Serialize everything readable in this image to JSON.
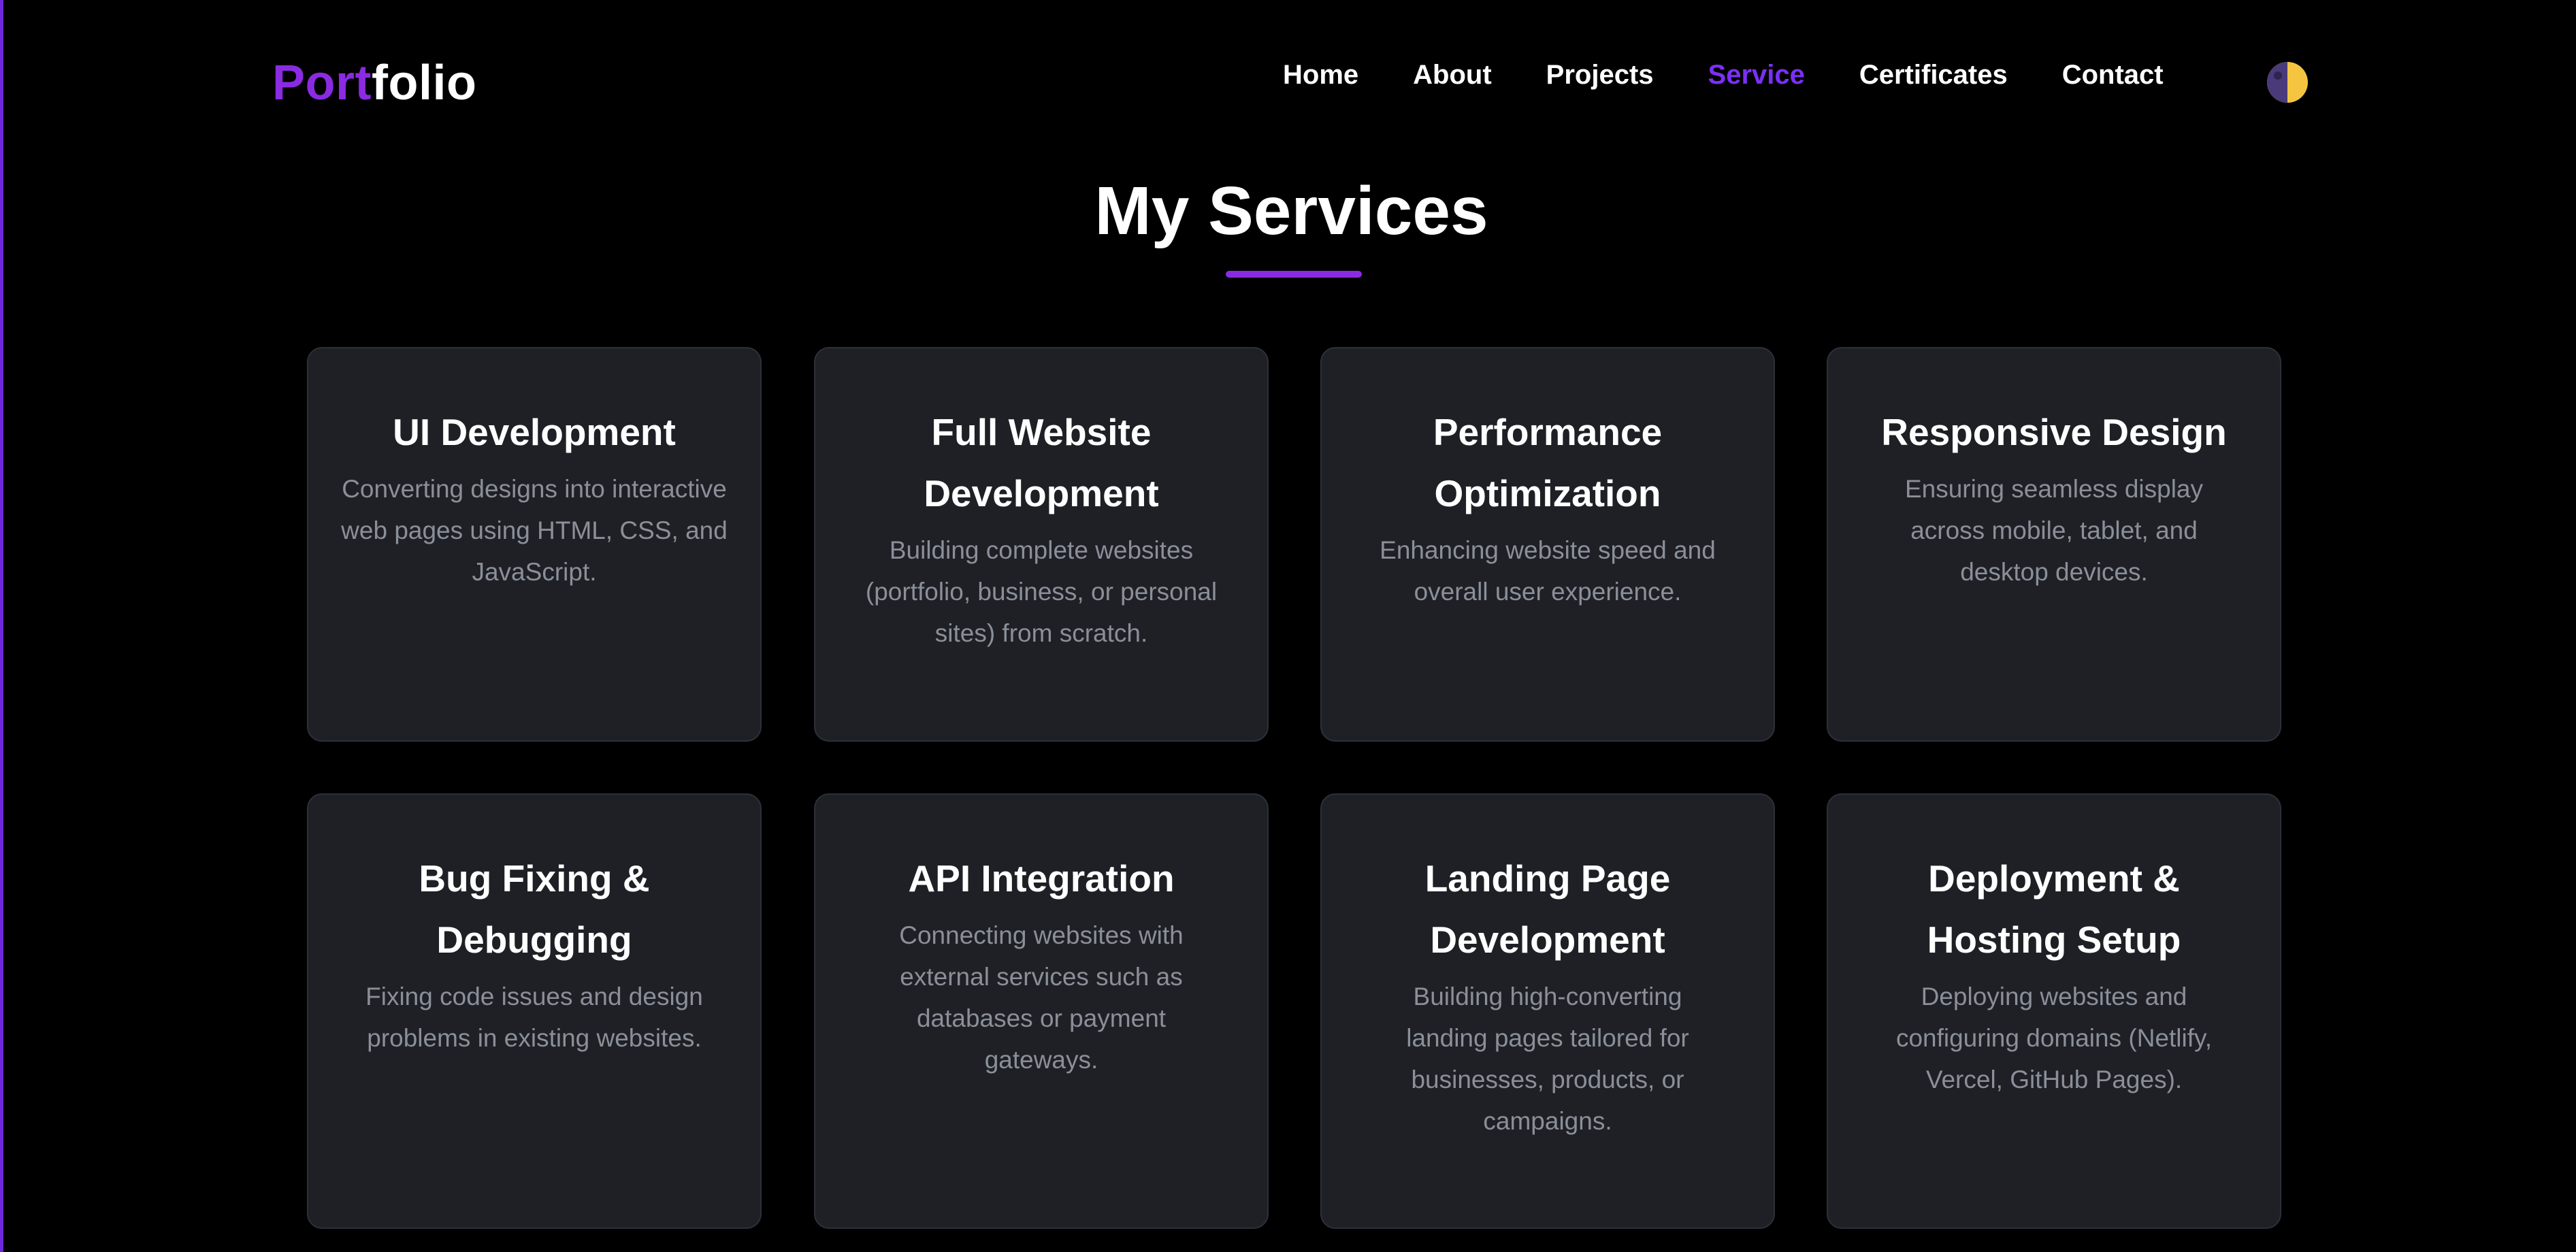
{
  "header": {
    "logo": {
      "accent": "Port",
      "rest": "folio"
    },
    "nav": [
      {
        "label": "Home",
        "active": false
      },
      {
        "label": "About",
        "active": false
      },
      {
        "label": "Projects",
        "active": false
      },
      {
        "label": "Service",
        "active": true
      },
      {
        "label": "Certificates",
        "active": false
      },
      {
        "label": "Contact",
        "active": false
      }
    ],
    "theme_toggle_icon": "half-moon-icon"
  },
  "services": {
    "title": "My Services",
    "cards": [
      {
        "title": "UI Development",
        "description": "Converting designs into interactive web pages using HTML, CSS, and JavaScript."
      },
      {
        "title": "Full Website Development",
        "description": "Building complete websites (portfolio, business, or personal sites) from scratch."
      },
      {
        "title": "Performance Optimization",
        "description": "Enhancing website speed and overall user experience."
      },
      {
        "title": "Responsive Design",
        "description": "Ensuring seamless display across mobile, tablet, and desktop devices."
      },
      {
        "title": "Bug Fixing & Debugging",
        "description": "Fixing code issues and design problems in existing websites."
      },
      {
        "title": "API Integration",
        "description": "Connecting websites with external services such as databases or payment gateways."
      },
      {
        "title": "Landing Page Development",
        "description": "Building high-converting landing pages tailored for businesses, products, or campaigns."
      },
      {
        "title": "Deployment & Hosting Setup",
        "description": "Deploying websites and configuring domains (Netlify, Vercel, GitHub Pages)."
      }
    ]
  },
  "colors": {
    "accent": "#8a2be2",
    "active_nav": "#7b2ff7",
    "background": "#000000",
    "card_background": "#1e2025",
    "card_border": "#2d3039",
    "muted_text": "#8a8f99"
  }
}
